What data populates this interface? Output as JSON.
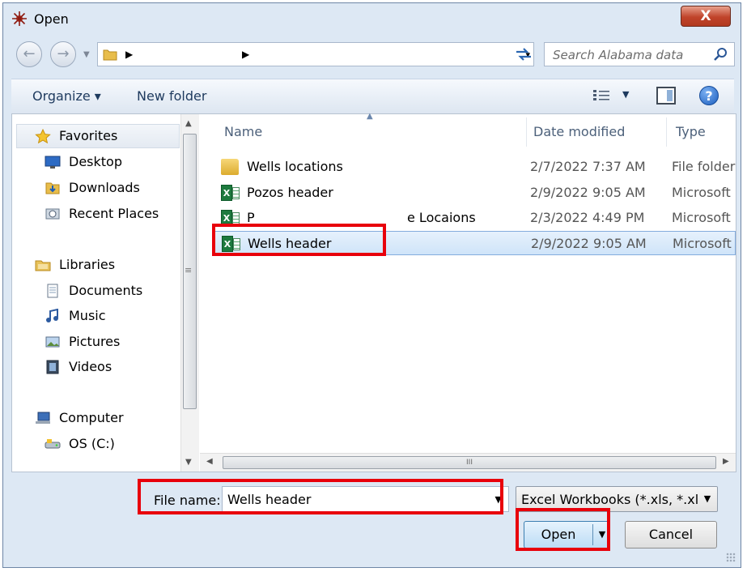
{
  "window": {
    "title": "Open",
    "close_label": "X"
  },
  "address": {
    "dropdown": "▾"
  },
  "search": {
    "placeholder": "Search Alabama data"
  },
  "toolbar": {
    "organize": "Organize ▾",
    "new_folder": "New folder",
    "help": "?"
  },
  "nav": {
    "favorites": "Favorites",
    "desktop": "Desktop",
    "downloads": "Downloads",
    "recent": "Recent Places",
    "libraries": "Libraries",
    "documents": "Documents",
    "music": "Music",
    "pictures": "Pictures",
    "videos": "Videos",
    "computer": "Computer",
    "os": "OS (C:)"
  },
  "columns": {
    "name": "Name",
    "date": "Date modified",
    "type": "Type"
  },
  "files": [
    {
      "name": "Wells locations",
      "date": "2/7/2022 7:37 AM",
      "type": "File folder",
      "icon": "folder-icon"
    },
    {
      "name": "Pozos header",
      "date": "2/9/2022 9:05 AM",
      "type": "Microsoft",
      "icon": "excel-icon"
    },
    {
      "name": "P",
      "name_tail": "e Locaions",
      "date": "2/3/2022 4:49 PM",
      "type": "Microsoft",
      "icon": "excel-icon"
    },
    {
      "name": "Wells  header",
      "date": "2/9/2022 9:05 AM",
      "type": "Microsoft",
      "icon": "excel-icon",
      "selected": true
    }
  ],
  "footer": {
    "file_name_label": "File name:",
    "file_name_value": "Wells  header",
    "file_type": "Excel Workbooks (*.xls, *.xlsx)",
    "open": "Open",
    "cancel": "Cancel"
  },
  "colors": {
    "highlight": "#e8000b",
    "selection": "#cfe4f9"
  }
}
